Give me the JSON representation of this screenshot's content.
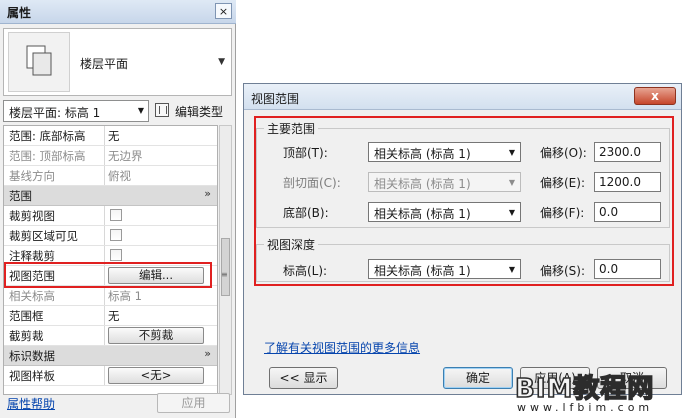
{
  "properties": {
    "title": "属性",
    "close_glyph": "×",
    "type_selector": {
      "name": "楼层平面"
    },
    "instance_filter": {
      "value": "楼层平面: 标高 1"
    },
    "edit_type_label": "编辑类型",
    "rows": [
      {
        "kind": "prop",
        "name": "范围: 底部标高",
        "value": "无",
        "disabled": false
      },
      {
        "kind": "prop",
        "name": "范围: 顶部标高",
        "value": "无边界",
        "disabled": true
      },
      {
        "kind": "prop",
        "name": "基线方向",
        "value": "俯视",
        "disabled": true
      },
      {
        "kind": "group",
        "name": "范围"
      },
      {
        "kind": "check",
        "name": "裁剪视图",
        "checked": false
      },
      {
        "kind": "check",
        "name": "裁剪区域可见",
        "checked": false
      },
      {
        "kind": "check",
        "name": "注释裁剪",
        "checked": false
      },
      {
        "kind": "button",
        "name": "视图范围",
        "value": "编辑..."
      },
      {
        "kind": "prop",
        "name": "相关标高",
        "value": "标高 1",
        "disabled": true
      },
      {
        "kind": "prop",
        "name": "范围框",
        "value": "无",
        "disabled": false
      },
      {
        "kind": "button",
        "name": "截剪裁",
        "value": "不剪裁"
      },
      {
        "kind": "group",
        "name": "标识数据"
      },
      {
        "kind": "button",
        "name": "视图样板",
        "value": "<无>"
      }
    ],
    "help_link": "属性帮助",
    "apply_label": "应用"
  },
  "dialog": {
    "title": "视图范围",
    "close_glyph": "x",
    "primary_range": {
      "legend": "主要范围",
      "rows": [
        {
          "label": "顶部(T):",
          "level": "相关标高 (标高 1)",
          "offset_label": "偏移(O):",
          "offset": "2300.0",
          "disabled": false
        },
        {
          "label": "剖切面(C):",
          "level": "相关标高 (标高 1)",
          "offset_label": "偏移(E):",
          "offset": "1200.0",
          "disabled": true
        },
        {
          "label": "底部(B):",
          "level": "相关标高 (标高 1)",
          "offset_label": "偏移(F):",
          "offset": "0.0",
          "disabled": false
        }
      ]
    },
    "view_depth": {
      "legend": "视图深度",
      "row": {
        "label": "标高(L):",
        "level": "相关标高 (标高 1)",
        "offset_label": "偏移(S):",
        "offset": "0.0"
      }
    },
    "learn_more_link": "了解有关视图范围的更多信息",
    "show_button": "<< 显示",
    "ok_button": "确定",
    "apply_button": "应用(A)",
    "cancel_button": "取消"
  },
  "watermark": {
    "brand": "BIM教程网",
    "url": "www.lfbim.com"
  },
  "colors": {
    "highlight": "#e02020",
    "link": "#0645ad"
  }
}
